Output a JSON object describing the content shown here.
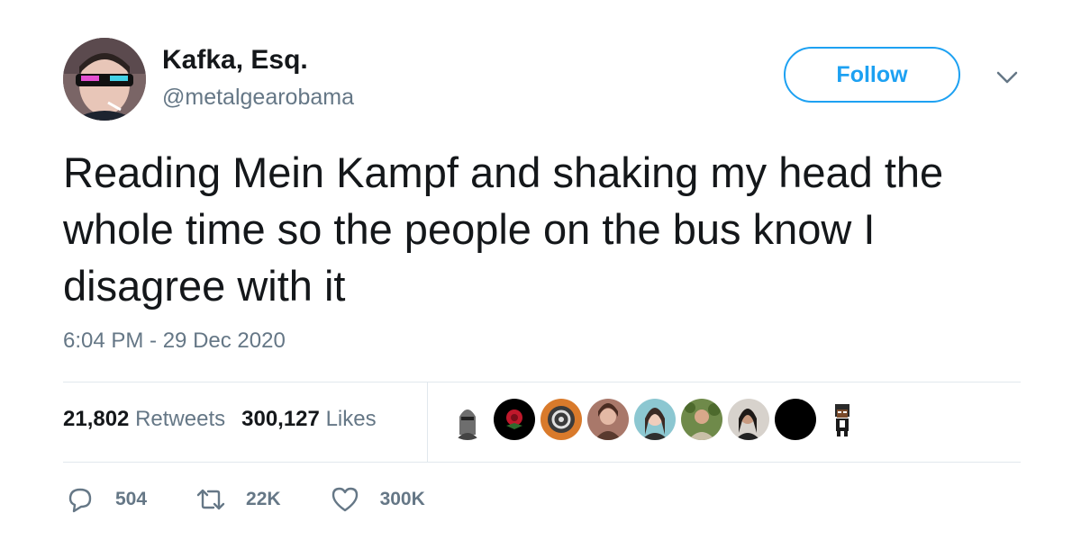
{
  "user": {
    "display_name": "Kafka, Esq.",
    "handle": "@metalgearobama"
  },
  "follow_button": {
    "label": "Follow"
  },
  "tweet": {
    "text": "Reading Mein Kampf and shaking my head the whole time so the people on the bus know I disagree with it",
    "timestamp": "6:04 PM - 29 Dec 2020"
  },
  "stats": {
    "retweets_count": "21,802",
    "retweets_label": "Retweets",
    "likes_count": "300,127",
    "likes_label": "Likes"
  },
  "actions": {
    "reply_count": "504",
    "retweet_count": "22K",
    "like_count": "300K"
  },
  "colors": {
    "accent": "#1da1f2",
    "text": "#14171a",
    "muted": "#657786",
    "divider": "#e1e8ed"
  }
}
